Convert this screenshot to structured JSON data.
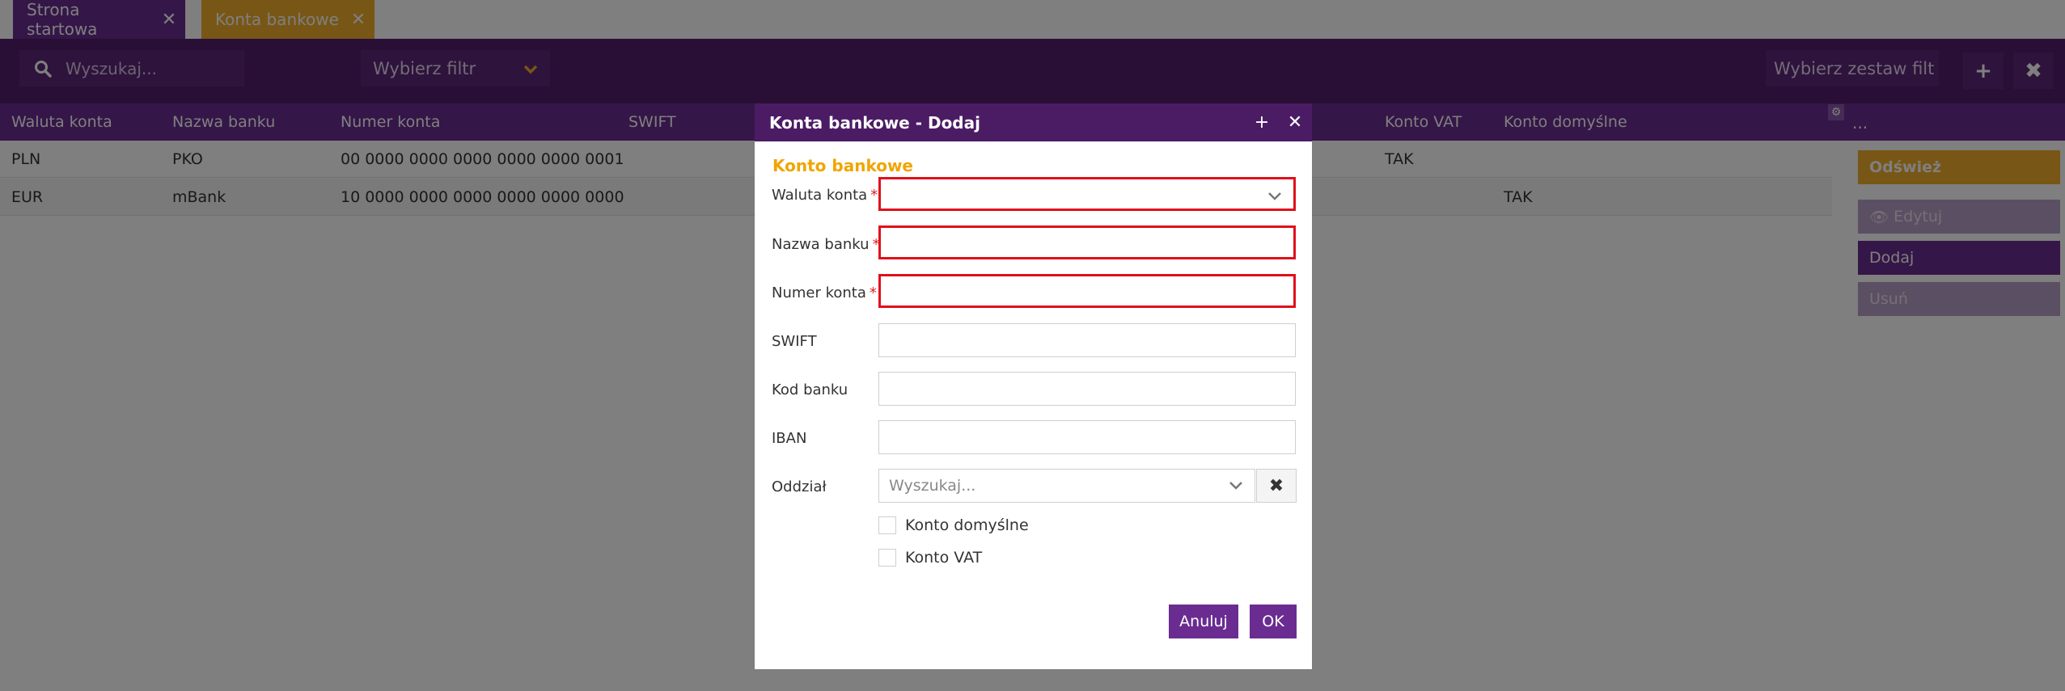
{
  "tabs": [
    {
      "label": "Strona startowa",
      "close": "✕"
    },
    {
      "label": "Konta bankowe",
      "close": "✕"
    }
  ],
  "toolbar": {
    "search_placeholder": "Wyszukaj...",
    "filter_label": "Wybierz filtr",
    "filterset_label": "Wybierz zestaw filt",
    "add_icon": "plus-icon",
    "clear_icon": "close-icon"
  },
  "grid": {
    "columns": [
      "Waluta konta",
      "Nazwa banku",
      "Numer konta",
      "SWIFT",
      "Konto VAT",
      "Konto domyślne"
    ],
    "more": "...",
    "rows": [
      {
        "waluta": "PLN",
        "bank": "PKO",
        "numer": "00 0000 0000 0000 0000 0000 0001",
        "swift": "",
        "vat": "TAK",
        "domyslne": ""
      },
      {
        "waluta": "EUR",
        "bank": "mBank",
        "numer": "10 0000 0000 0000 0000 0000 0000",
        "swift": "",
        "vat": "",
        "domyslne": "TAK"
      }
    ]
  },
  "side_buttons": {
    "refresh": "Odśwież",
    "edit": "Edytuj",
    "add": "Dodaj",
    "delete": "Usuń"
  },
  "modal": {
    "title": "Konta bankowe - Dodaj",
    "section": "Konto bankowe",
    "fields": {
      "waluta": "Waluta konta",
      "nazwa": "Nazwa banku",
      "numer": "Numer konta",
      "swift": "SWIFT",
      "kod": "Kod banku",
      "iban": "IBAN",
      "oddzial": "Oddział"
    },
    "required_mark": "*",
    "oddzial_placeholder": "Wyszukaj...",
    "checkbox_default": "Konto domyślne",
    "checkbox_vat": "Konto VAT",
    "cancel": "Anuluj",
    "ok": "OK"
  },
  "colors": {
    "primary": "#6a2c91",
    "dark": "#4b1c64",
    "accent": "#f0ad2b",
    "error": "#e0101a"
  }
}
